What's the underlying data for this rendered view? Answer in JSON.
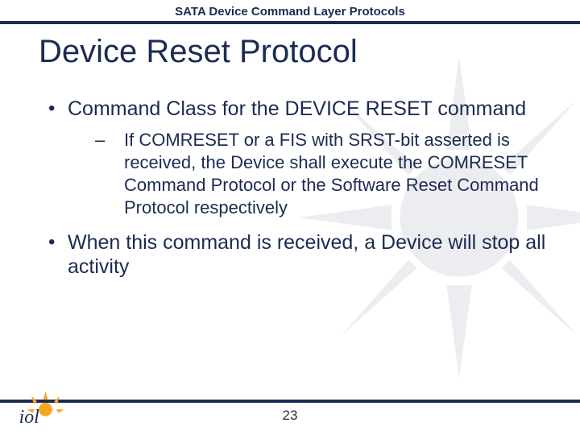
{
  "header": {
    "subtitle": "SATA Device Command Layer Protocols"
  },
  "title": "Device Reset Protocol",
  "bullets": [
    {
      "level": 1,
      "text": "Command Class for the DEVICE RESET command",
      "children": [
        {
          "level": 2,
          "text": "If COMRESET or a FIS with SRST-bit asserted is received, the Device shall execute the COMRESET Command Protocol or the Software Reset Command Protocol respectively"
        }
      ]
    },
    {
      "level": 1,
      "text": "When this command is received, a Device will stop all activity",
      "children": []
    }
  ],
  "page_number": "23",
  "logo_text": "iol",
  "colors": {
    "brand_navy": "#1b2b52"
  }
}
